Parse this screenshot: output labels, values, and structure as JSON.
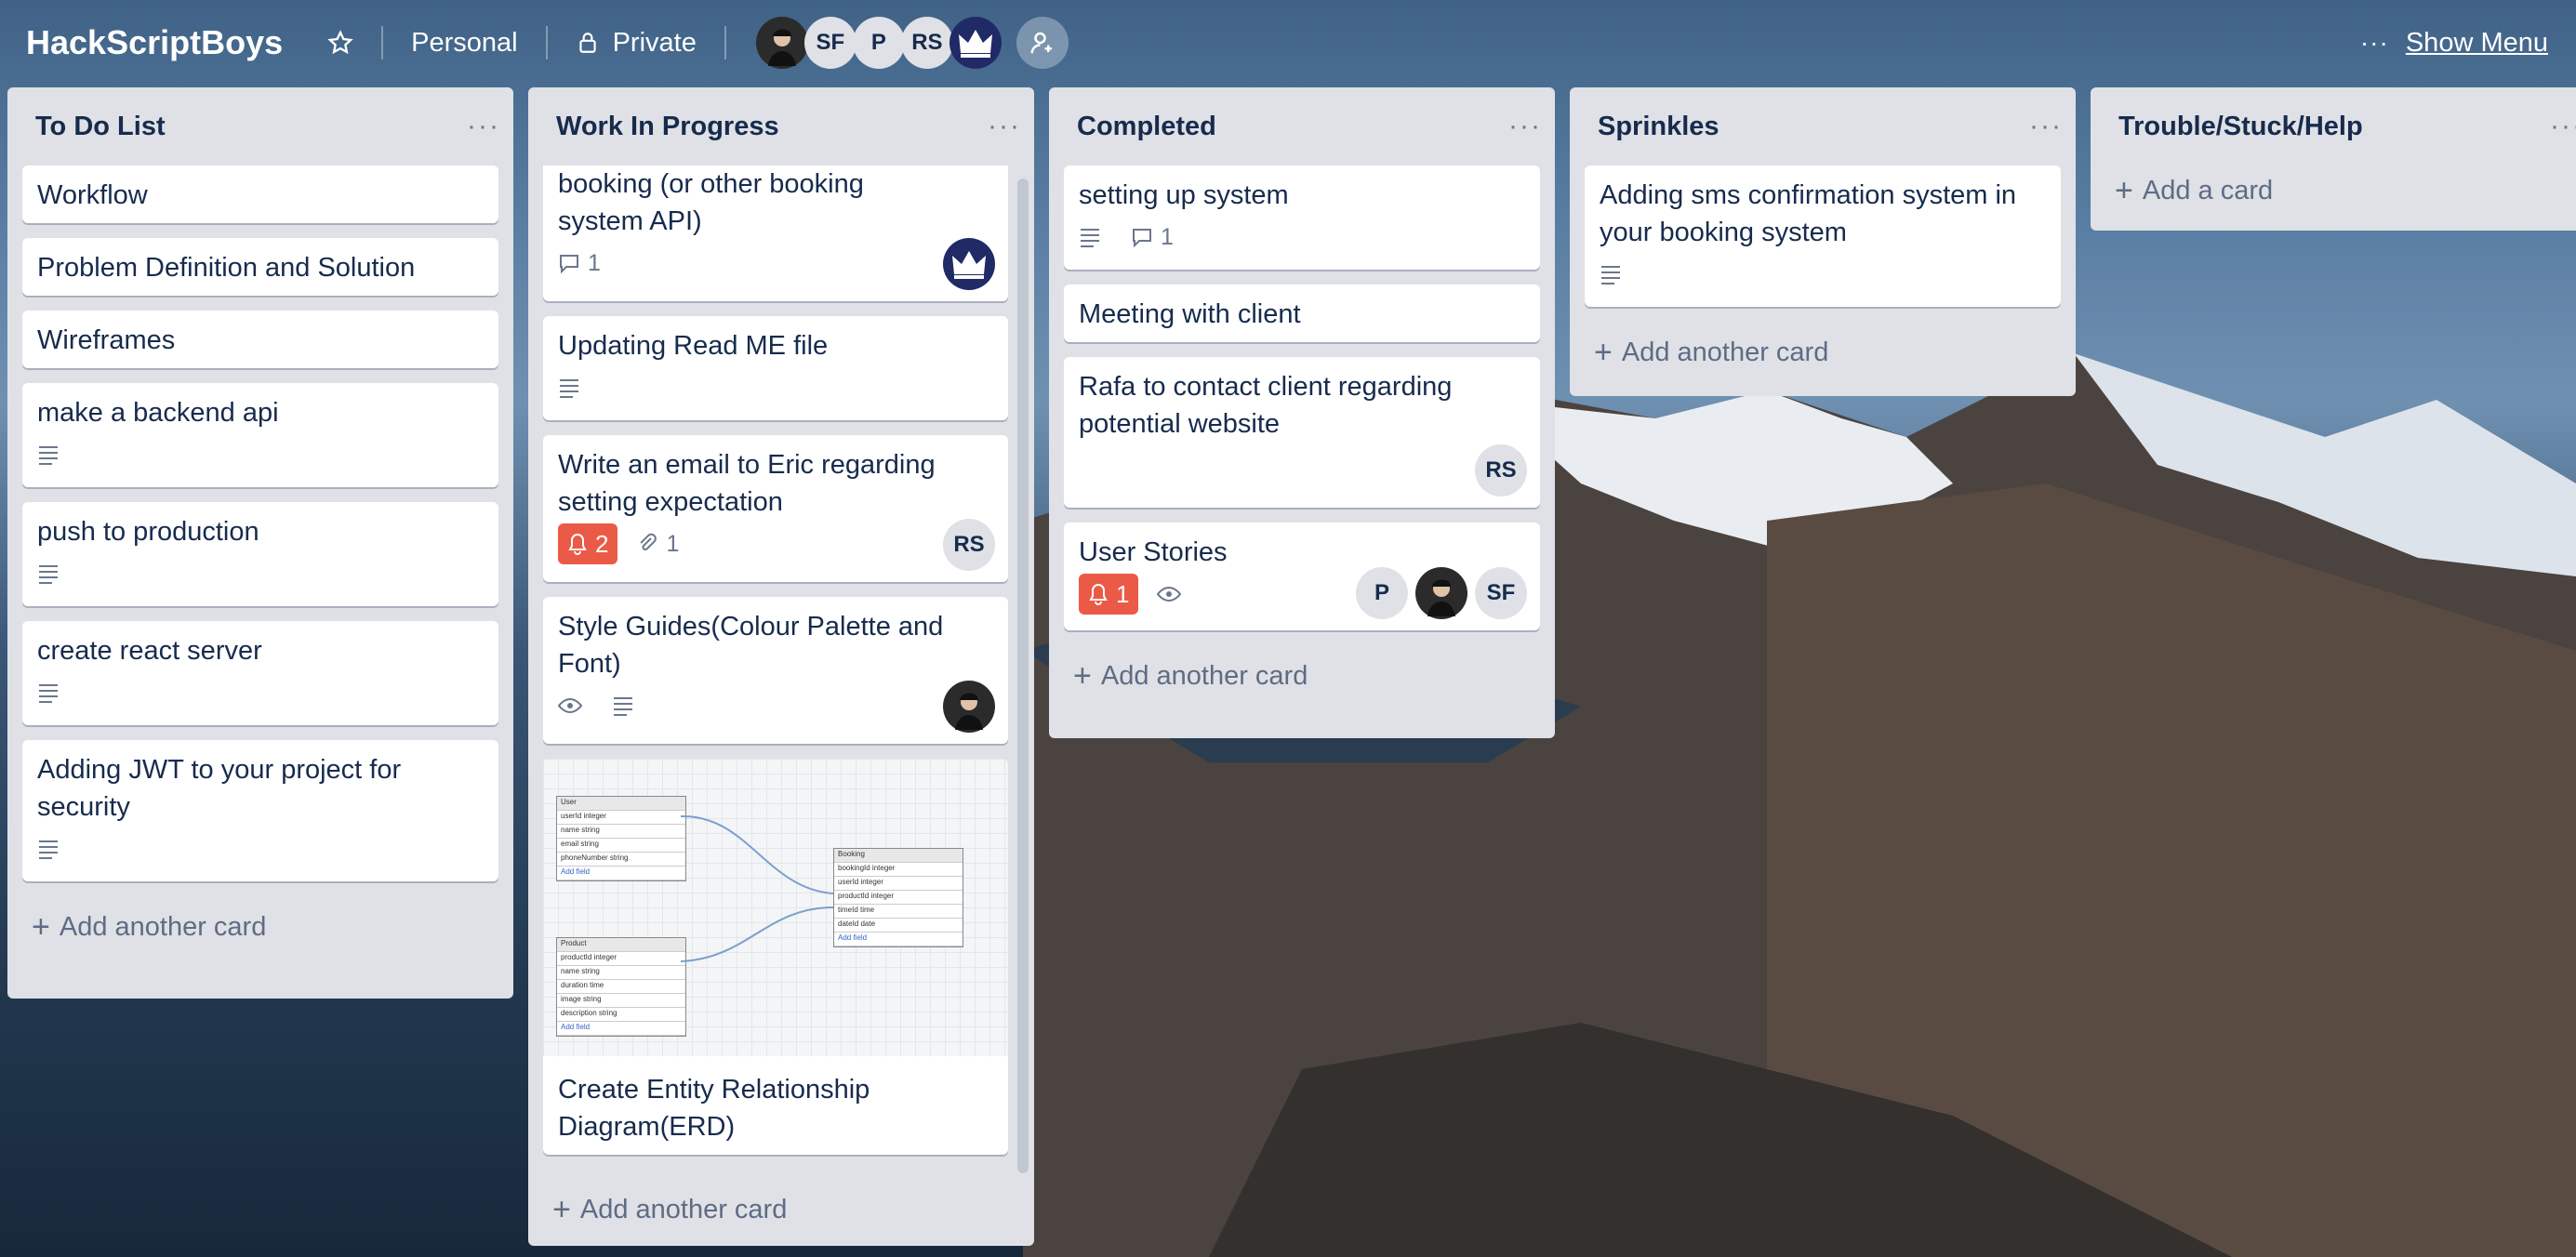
{
  "header": {
    "board_title": "HackScriptBoys",
    "team": "Personal",
    "visibility": "Private",
    "avatars": [
      "",
      "SF",
      "P",
      "RS",
      ""
    ],
    "show_menu": "Show Menu",
    "dots": "···"
  },
  "lists": [
    {
      "title": "To Do List",
      "cards": [
        "Workflow",
        "Problem Definition and Solution",
        "Wireframes",
        "make a backend api",
        "push to production",
        "create react server",
        "Adding JWT to your project for security"
      ],
      "add": "Add another card"
    },
    {
      "title": "Work In Progress",
      "cards": [
        {
          "title": "booking (or other booking system API)",
          "comments": "1"
        },
        {
          "title": "Updating Read ME file"
        },
        {
          "title": "Write an email to Eric regarding setting expectation",
          "alert": "2",
          "attachments": "1",
          "member": "RS"
        },
        {
          "title": "Style Guides(Colour Palette and Font)"
        },
        {
          "title": "Create Entity Relationship Diagram(ERD)"
        }
      ],
      "add": "Add another card"
    },
    {
      "title": "Completed",
      "cards": [
        {
          "title": "setting up system",
          "comments": "1"
        },
        {
          "title": "Meeting with client"
        },
        {
          "title": "Rafa to contact client regarding potential website",
          "member": "RS"
        },
        {
          "title": "User Stories",
          "alert": "1",
          "members": [
            "P",
            "",
            "SF"
          ]
        }
      ],
      "add": "Add another card"
    },
    {
      "title": "Sprinkles",
      "cards": [
        {
          "title": "Adding sms confirmation system in your booking system"
        }
      ],
      "add": "Add another card"
    },
    {
      "title": "Trouble/Stuck/Help",
      "add": "Add a card"
    }
  ],
  "erd": {
    "user": [
      "User",
      "userId integer",
      "name string",
      "email string",
      "phoneNumber string",
      "Add field"
    ],
    "booking": [
      "Booking",
      "bookingId integer",
      "userId integer",
      "productId integer",
      "timeId time",
      "dateId date",
      "Add field"
    ],
    "product": [
      "Product",
      "productId integer",
      "name string",
      "duration time",
      "image string",
      "description string",
      "Add field"
    ]
  },
  "colors": {
    "alert": "#eb5a46",
    "list_bg": "#dfe1e6",
    "text": "#172b4d"
  }
}
